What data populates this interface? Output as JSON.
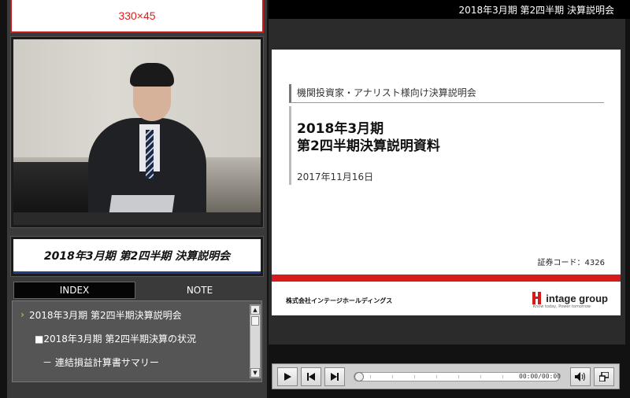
{
  "banner": {
    "text": "330×45"
  },
  "session_title": "2018年3月期 第2四半期 決算説明会",
  "tabs": {
    "index": "INDEX",
    "note": "NOTE"
  },
  "index_items": [
    {
      "label": "2018年3月期 第2四半期決算説明会",
      "marker": "›"
    },
    {
      "label": "■2018年3月期 第2四半期決算の状況"
    },
    {
      "label": "－ 連結損益計算書サマリー"
    }
  ],
  "header": {
    "title": "2018年3月期  第2四半期 決算説明会"
  },
  "slide": {
    "subtitle": "機関投資家・アナリスト様向け決算説明会",
    "title_line1": "2018年3月期",
    "title_line2": "第2四半期決算説明資料",
    "date": "2017年11月16日",
    "security_code": "証券コード：4326",
    "company": "株式会社インテージホールディングス",
    "logo_text": "intage group",
    "logo_tagline": "Know today, Power tomorrow"
  },
  "player": {
    "time": "00:00/00:00",
    "icons": [
      "play-icon",
      "prev-icon",
      "next-icon",
      "volume-icon",
      "window-icon"
    ]
  },
  "colors": {
    "accent_red": "#d71a1a",
    "nav_blue": "#1f3f8a",
    "arrow_green": "#7fd32c"
  }
}
